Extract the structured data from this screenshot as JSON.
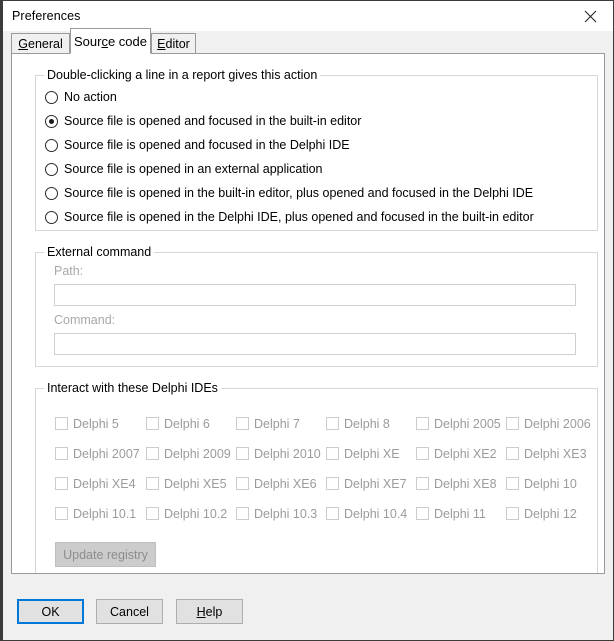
{
  "window": {
    "title": "Preferences",
    "close_icon": "close-icon"
  },
  "tabs": [
    {
      "label": "General",
      "accel": "G",
      "active": false
    },
    {
      "label": "Source code",
      "accel": "c",
      "active": true
    },
    {
      "label": "Editor",
      "accel": "E",
      "active": false
    }
  ],
  "action_group": {
    "legend": "Double-clicking a line in a report gives this action",
    "options": [
      {
        "label": "No action",
        "checked": false
      },
      {
        "label": "Source file is opened and focused in the built-in editor",
        "checked": true
      },
      {
        "label": "Source file is opened and focused in the Delphi IDE",
        "checked": false
      },
      {
        "label": "Source file is opened in an external application",
        "checked": false
      },
      {
        "label": "Source file is opened in the built-in editor, plus opened and focused in the Delphi IDE",
        "checked": false
      },
      {
        "label": "Source file is opened in the Delphi IDE, plus opened and focused in the built-in editor",
        "checked": false
      }
    ]
  },
  "external_command": {
    "legend": "External command",
    "path_label": "Path:",
    "path_value": "",
    "command_label": "Command:",
    "command_value": ""
  },
  "delphi_ides": {
    "legend": "Interact with these Delphi IDEs",
    "rows": [
      [
        "Delphi 5",
        "Delphi 6",
        "Delphi 7",
        "Delphi 8",
        "Delphi 2005",
        "Delphi 2006"
      ],
      [
        "Delphi 2007",
        "Delphi 2009",
        "Delphi 2010",
        "Delphi XE",
        "Delphi XE2",
        "Delphi XE3"
      ],
      [
        "Delphi XE4",
        "Delphi XE5",
        "Delphi XE6",
        "Delphi XE7",
        "Delphi XE8",
        "Delphi 10"
      ],
      [
        "Delphi 10.1",
        "Delphi 10.2",
        "Delphi 10.3",
        "Delphi 10.4",
        "Delphi 11",
        "Delphi 12"
      ]
    ],
    "update_registry_label": "Update registry"
  },
  "footer": {
    "ok_label": "OK",
    "cancel_label": "Cancel",
    "help_label": "Help",
    "help_accel": "H",
    "accent_color": "#0078d7"
  }
}
